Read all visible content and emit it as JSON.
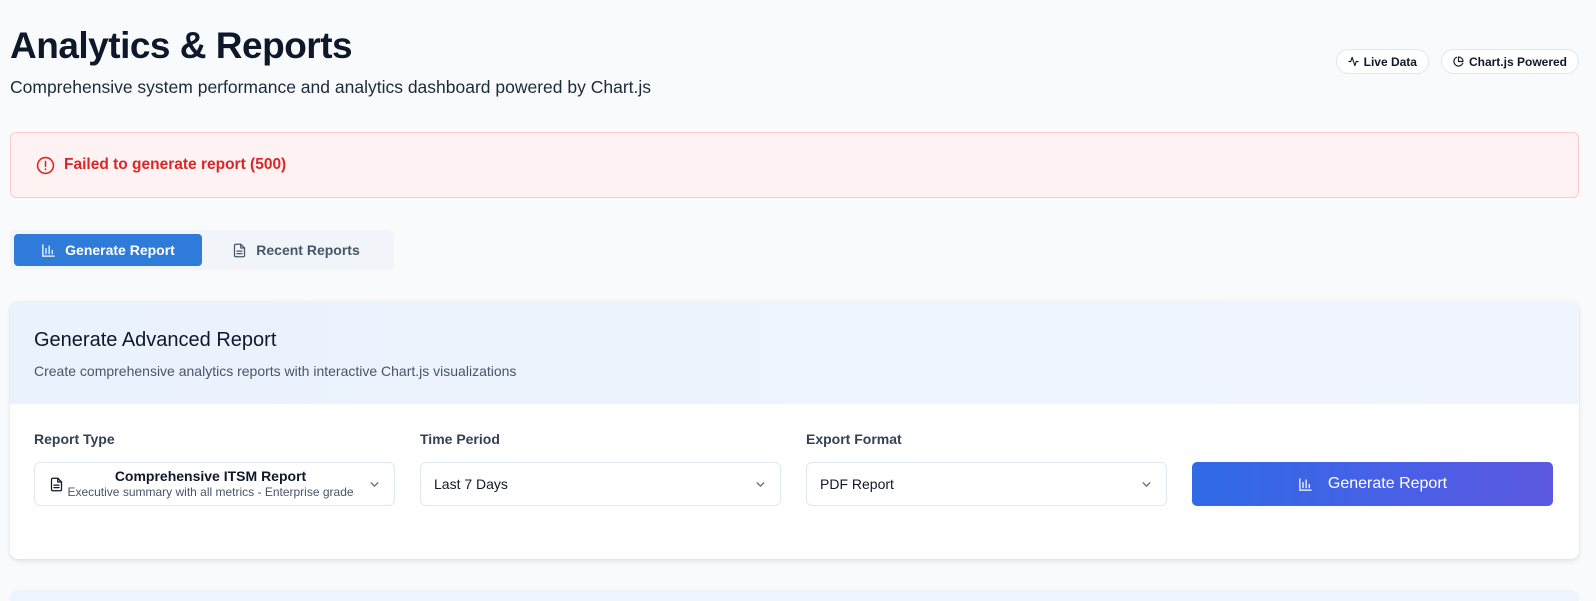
{
  "header": {
    "title": "Analytics & Reports",
    "subtitle": "Comprehensive system performance and analytics dashboard powered by Chart.js",
    "badges": [
      {
        "label": "Live Data",
        "icon": "activity-icon"
      },
      {
        "label": "Chart.js Powered",
        "icon": "pie-chart-icon"
      }
    ]
  },
  "alert": {
    "message": "Failed to generate report (500)",
    "icon": "alert-circle-icon",
    "color": "#dc2626"
  },
  "tabs": [
    {
      "label": "Generate Report",
      "icon": "bar-chart-icon",
      "active": true
    },
    {
      "label": "Recent Reports",
      "icon": "file-text-icon",
      "active": false
    }
  ],
  "card": {
    "title": "Generate Advanced Report",
    "description": "Create comprehensive analytics reports with interactive Chart.js visualizations",
    "report_type": {
      "label": "Report Type",
      "value": "Comprehensive ITSM Report",
      "subtext": "Executive summary with all metrics - Enterprise grade"
    },
    "time_period": {
      "label": "Time Period",
      "value": "Last 7 Days"
    },
    "export_format": {
      "label": "Export Format",
      "value": "PDF Report"
    },
    "generate_button": "Generate Report"
  },
  "colors": {
    "primary": "#2f7bd9",
    "error": "#dc2626",
    "button_gradient_start": "#2f6be6",
    "button_gradient_end": "#5b57e0"
  }
}
